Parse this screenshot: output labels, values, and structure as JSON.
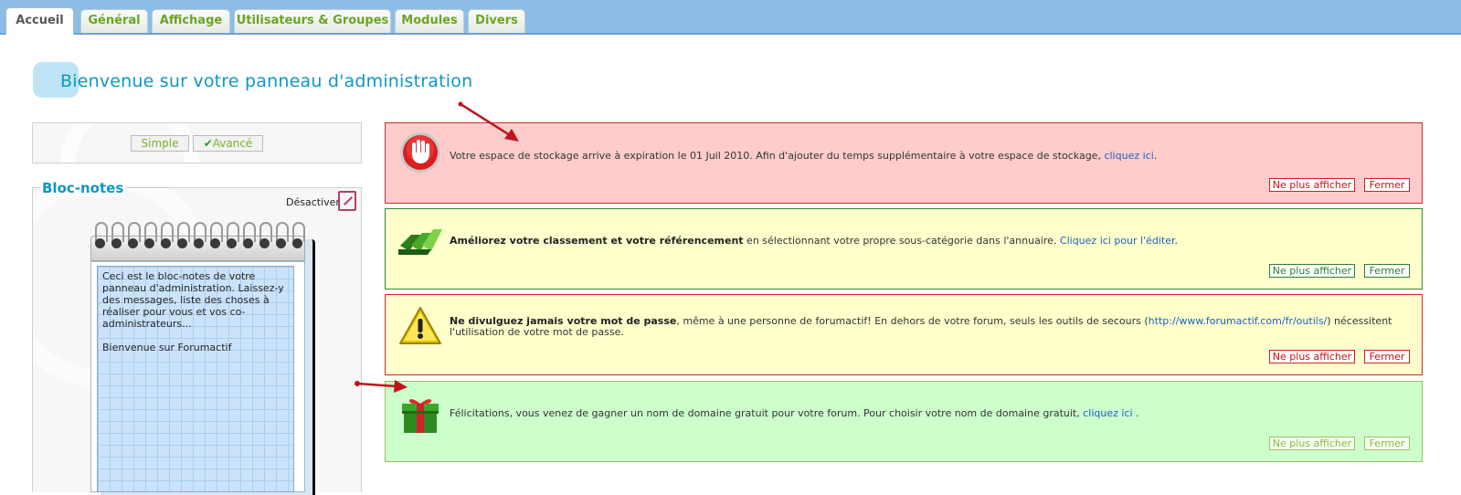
{
  "tabs": [
    {
      "label": "Accueil",
      "active": true
    },
    {
      "label": "Général",
      "active": false
    },
    {
      "label": "Affichage",
      "active": false
    },
    {
      "label": "Utilisateurs & Groupes",
      "active": false
    },
    {
      "label": "Modules",
      "active": false
    },
    {
      "label": "Divers",
      "active": false
    }
  ],
  "page_title": "Bienvenue sur votre panneau d'administration",
  "mode": {
    "simple_label": "Simple",
    "advanced_label": "Avancé",
    "selected": "Avancé"
  },
  "notepad": {
    "title": "Bloc-notes",
    "disable_label": "Désactiver",
    "text": "Ceci est le bloc-notes de votre panneau d'administration. Laissez-y des messages, liste des choses à réaliser pour vous et vos co-administrateurs...\n\nBienvenue sur Forumactif"
  },
  "notices": {
    "storage": {
      "text": "Votre espace de stockage arrive à expiration le 01 Juil 2010. Afin d'ajouter du temps supplémentaire à votre espace de stockage, ",
      "link": "cliquez ici",
      "tail": ".",
      "hide_label": "Ne plus afficher",
      "close_label": "Fermer",
      "icon": "stop-hand-icon",
      "color": "#ffcccc"
    },
    "ranking": {
      "bold": "Améliorez votre classement et votre référencement",
      "text": " en sélectionnant votre propre sous-catégorie dans l'annuaire. ",
      "link": "Cliquez ici pour l'éditer",
      "tail": ".",
      "hide_label": "Ne plus afficher",
      "close_label": "Fermer",
      "icon": "green-arrows-icon",
      "color": "#ffffcc"
    },
    "password": {
      "bold": "Ne divulguez jamais votre mot de passe",
      "text": ", même à une personne de forumactif! En dehors de votre forum, seuls les outils de secours (",
      "link": "http://www.forumactif.com/fr/outils/",
      "tail": ") nécessitent l'utilisation de votre mot de passe.",
      "hide_label": "Ne plus afficher",
      "close_label": "Fermer",
      "icon": "warning-icon",
      "color": "#ffffcc"
    },
    "domain": {
      "text": "Félicitations, vous venez de gagner un nom de domaine gratuit pour votre forum. Pour choisir votre nom de domaine gratuit, ",
      "link": "cliquez ici",
      "tail": " .",
      "hide_label": "Ne plus afficher",
      "close_label": "Fermer",
      "icon": "gift-icon",
      "color": "#ccffcc"
    }
  }
}
